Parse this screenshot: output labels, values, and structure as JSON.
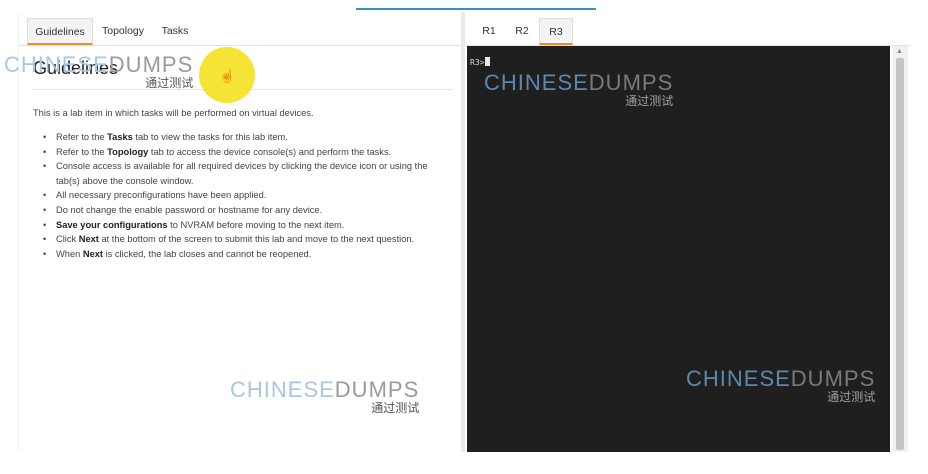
{
  "left_tabs": [
    {
      "label": "Guidelines"
    },
    {
      "label": "Topology"
    },
    {
      "label": "Tasks"
    }
  ],
  "guidelines": {
    "heading": "Guidelines",
    "intro": "This is a lab item in which tasks will be performed on virtual devices.",
    "items": [
      {
        "pre": "Refer to the ",
        "bold": "Tasks",
        "post": " tab to view the tasks for this lab item."
      },
      {
        "pre": "Refer to the ",
        "bold": "Topology",
        "post": " tab to access the device console(s) and perform the tasks."
      },
      {
        "pre": "Console access is available for all required devices by clicking the device icon or using the tab(s) above the console window.",
        "bold": "",
        "post": ""
      },
      {
        "pre": "All necessary preconfigurations have been applied.",
        "bold": "",
        "post": ""
      },
      {
        "pre": "Do not change the enable password or hostname for any device.",
        "bold": "",
        "post": ""
      },
      {
        "pre": "",
        "bold": "Save your configurations",
        "post": " to NVRAM before moving to the next item."
      },
      {
        "pre": "Click ",
        "bold": "Next",
        "post": " at the bottom of the screen to submit this lab and move to the next question."
      },
      {
        "pre": "When ",
        "bold": "Next",
        "post": " is clicked, the lab closes and cannot be reopened."
      }
    ]
  },
  "device_tabs": [
    {
      "label": "R1"
    },
    {
      "label": "R2"
    },
    {
      "label": "R3"
    }
  ],
  "active_left_tab": "Guidelines",
  "active_device_tab": "R3",
  "console": {
    "prompt": "R3>"
  },
  "watermark": {
    "part1": "CHINESE",
    "part2": "DUMPS",
    "sub": "通过测试"
  },
  "icons": {
    "cursor": "hand-pointer-icon",
    "scroll_up": "scroll-up-arrow-icon"
  },
  "colors": {
    "accent": "#f28c28",
    "console_bg": "#1f1f1f",
    "highlight": "#f4e22a"
  }
}
